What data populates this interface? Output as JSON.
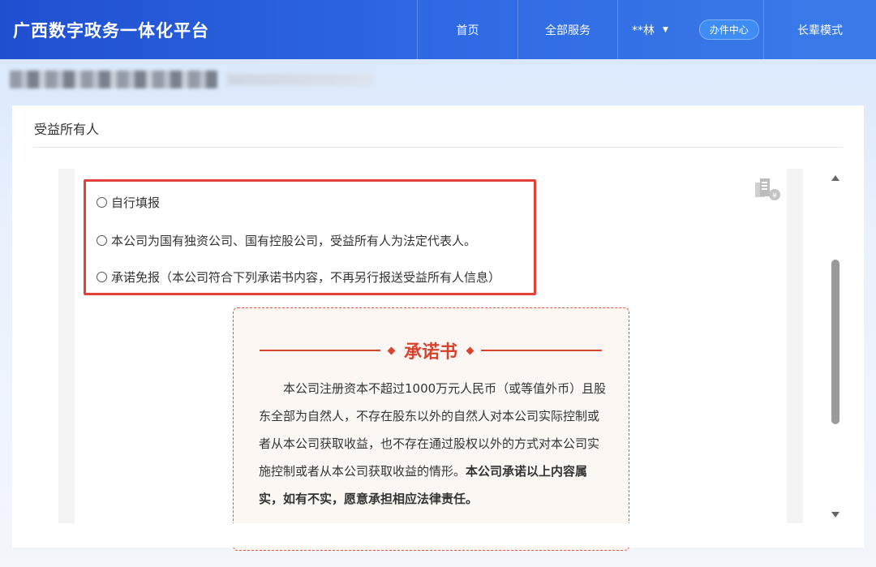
{
  "header": {
    "brand": "广西数字政务一体化平台",
    "nav": {
      "home": "首页",
      "all_services": "全部服务",
      "user": "**林",
      "office_center": "办件中心",
      "elder_mode": "长辈模式"
    }
  },
  "card": {
    "title": "受益所有人"
  },
  "options": [
    "自行填报",
    "本公司为国有独资公司、国有控股公司，受益所有人为法定代表人。",
    "承诺免报（本公司符合下列承诺书内容，不再另行报送受益所有人信息）"
  ],
  "pledge": {
    "title": "承诺书",
    "body_normal": "本公司注册资本不超过1000万元人民币（或等值外币）且股东全部为自然人，不存在股东以外的自然人对本公司实际控制或者从本公司获取收益，也不存在通过股权以外的方式对本公司实施控制或者从本公司获取收益的情形。",
    "body_bold": "本公司承诺以上内容属实，如有不实，愿意承担相应法律责任。"
  },
  "colors": {
    "header_start": "#1f4fd0",
    "header_end": "#3b7be9",
    "highlight_border": "#e4403a",
    "pledge_accent": "#d8432e"
  },
  "icons": {
    "user_dropdown": "caret-down-icon",
    "side_doc": "document-yuan-icon"
  }
}
